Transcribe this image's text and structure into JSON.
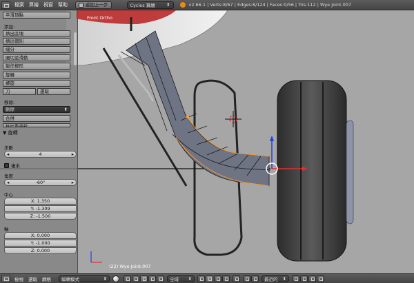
{
  "topbar": {
    "menus": [
      "檔案",
      "算繪",
      "視窗",
      "幫助"
    ],
    "undo_label": "返回上一步",
    "engine": "Cycles 算繪",
    "stats": "v2.66.1 | Verts:8/67 | Edges:8/124 | Faces:0/56 | Tris:112 | Wye Joint.007"
  },
  "viewport": {
    "view_name": "Front Ortho",
    "object_info": "(22) Wye Joint.007",
    "colors": {
      "background": "#a6a6a6",
      "mesh_face": "#6f7688",
      "selected": "#ff9c2a",
      "x_axis": "#e03030",
      "z_axis": "#2040e0"
    }
  },
  "toolshelf": {
    "top_button": "平滑頂點",
    "add_heading": "添加:",
    "add_items": [
      "擠出區塊",
      "擠出個別",
      "細分",
      "圈切並滑動",
      "製作楔形",
      "旋轉",
      "螺旋"
    ],
    "knife": "刀",
    "select": "選取",
    "remove_heading": "移除:",
    "delete_select": "刪除",
    "merge": "合併",
    "remove_doubles": "移除重疊點"
  },
  "redo_panel": {
    "title": "▼ 旋轉",
    "steps_label": "步數",
    "steps_value": "4",
    "dupli_label": "複本",
    "angle_label": "角度",
    "angle_value": "-60°",
    "center_label": "中心",
    "center": [
      {
        "axis": "X:",
        "value": "1.350"
      },
      {
        "axis": "Y:",
        "value": "-1.309"
      },
      {
        "axis": "Z:",
        "value": "-1.500"
      }
    ],
    "axis_label": "軸",
    "axis": [
      {
        "axis": "X:",
        "value": "0.000"
      },
      {
        "axis": "Y:",
        "value": "-1.000"
      },
      {
        "axis": "Z:",
        "value": "0.000"
      }
    ]
  },
  "bottombar": {
    "menus": [
      "檢視",
      "選取",
      "網格"
    ],
    "mode": "編輯模式",
    "pivot": "全域",
    "snap": "最近的"
  }
}
